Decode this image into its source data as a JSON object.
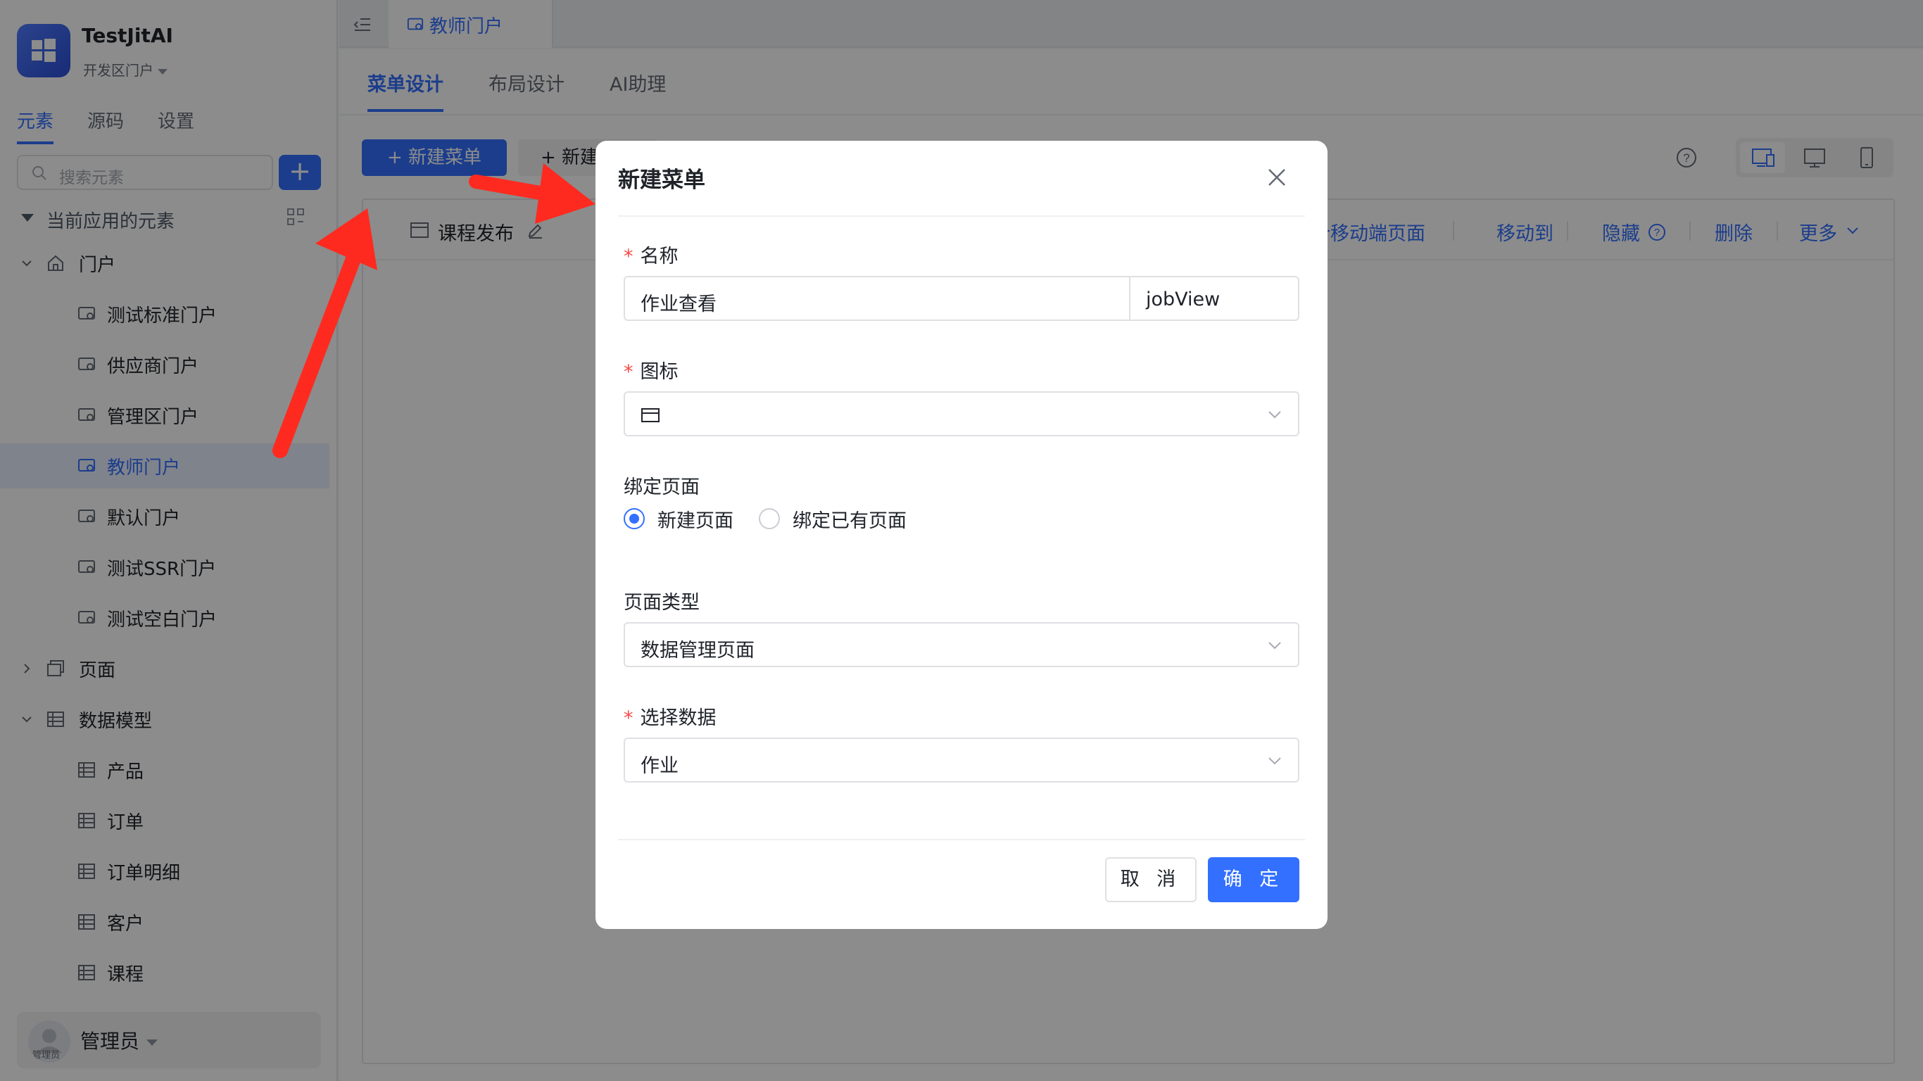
{
  "app": {
    "name": "TestJitAI",
    "portal": "开发区门户"
  },
  "sidebar": {
    "tabs": [
      "元素",
      "源码",
      "设置"
    ],
    "active_tab": "元素",
    "search_placeholder": "搜索元素",
    "add_label": "+",
    "section_title": "当前应用的元素",
    "tree": [
      {
        "label": "门户",
        "level": 0,
        "expanded": true,
        "icon": "home-icon"
      },
      {
        "label": "测试标准门户",
        "level": 1,
        "icon": "portal-icon"
      },
      {
        "label": "供应商门户",
        "level": 1,
        "icon": "portal-icon"
      },
      {
        "label": "管理区门户",
        "level": 1,
        "icon": "portal-icon"
      },
      {
        "label": "教师门户",
        "level": 1,
        "icon": "portal-icon",
        "selected": true
      },
      {
        "label": "默认门户",
        "level": 1,
        "icon": "portal-icon"
      },
      {
        "label": "测试SSR门户",
        "level": 1,
        "icon": "portal-icon"
      },
      {
        "label": "测试空白门户",
        "level": 1,
        "icon": "portal-icon"
      },
      {
        "label": "页面",
        "level": 0,
        "expanded": false,
        "icon": "page-icon"
      },
      {
        "label": "数据模型",
        "level": 0,
        "expanded": true,
        "icon": "table-icon"
      },
      {
        "label": "产品",
        "level": 1,
        "icon": "table-icon"
      },
      {
        "label": "订单",
        "level": 1,
        "icon": "table-icon"
      },
      {
        "label": "订单明细",
        "level": 1,
        "icon": "table-icon"
      },
      {
        "label": "客户",
        "level": 1,
        "icon": "table-icon"
      },
      {
        "label": "课程",
        "level": 1,
        "icon": "table-icon"
      }
    ],
    "user": {
      "name": "管理员",
      "avatar_badge": "管理员"
    }
  },
  "topbar": {
    "doc_tab": "教师门户"
  },
  "main": {
    "tabs": [
      "菜单设计",
      "布局设计",
      "AI助理"
    ],
    "active_tab": "菜单设计",
    "new_menu_button": "+ 新建菜单",
    "new_other_button": "+ 新建",
    "menu_item": "课程发布",
    "actions": [
      "设计移动端页面",
      "移动到",
      "隐藏",
      "删除",
      "更多"
    ]
  },
  "modal": {
    "title": "新建菜单",
    "name_label": "名称",
    "name_value": "作业查看",
    "name_code": "jobView",
    "icon_label": "图标",
    "bind_label": "绑定页面",
    "bind_options": [
      "新建页面",
      "绑定已有页面"
    ],
    "bind_selected": "新建页面",
    "page_type_label": "页面类型",
    "page_type_value": "数据管理页面",
    "data_label": "选择数据",
    "data_value": "作业",
    "cancel": "取 消",
    "confirm": "确 定"
  },
  "colors": {
    "accent": "#3370ff",
    "required": "#f54a45",
    "annotation_arrow": "#ff2a1f"
  }
}
